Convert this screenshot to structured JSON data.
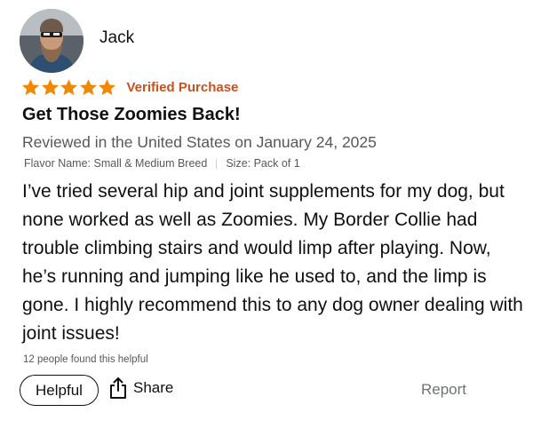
{
  "reviewer": {
    "name": "Jack",
    "avatar_icon": "profile-photo"
  },
  "rating": {
    "stars": 5,
    "max_stars": 5,
    "star_color": "#f08804",
    "badge": "Verified Purchase",
    "badge_color": "#c7511f"
  },
  "review": {
    "title": "Get Those Zoomies Back!",
    "date_line": "Reviewed in the United States on January 24, 2025",
    "flavor": "Flavor Name: Small & Medium Breed",
    "size": "Size: Pack of 1",
    "body": "I’ve tried several hip and joint supplements for my dog, but none worked as well as Zoomies. My Border Collie had trouble climbing stairs and would limp after playing. Now, he’s running and jumping like he used to, and the limp is gone. I highly recommend this to any dog owner dealing with joint issues!",
    "helpful_count": "12 people found this helpful"
  },
  "actions": {
    "helpful_label": "Helpful",
    "share_label": "Share",
    "share_icon": "share-icon",
    "report_label": "Report"
  }
}
